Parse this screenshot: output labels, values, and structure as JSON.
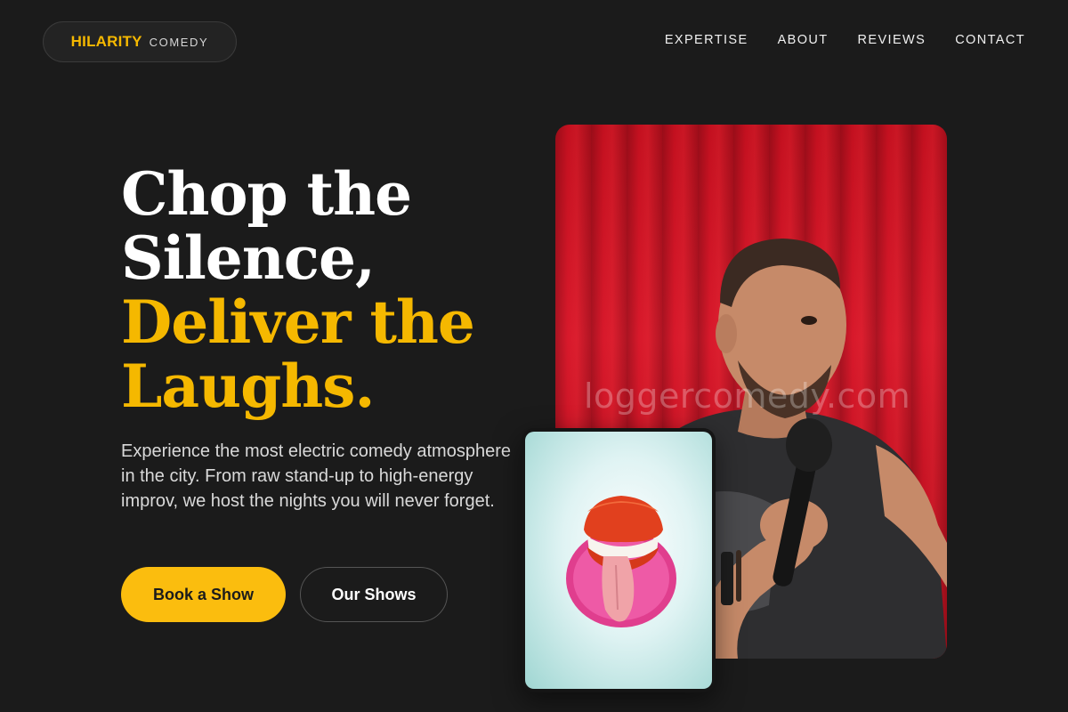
{
  "brand": {
    "name": "HILARITY",
    "suffix": "COMEDY",
    "accent_color": "#f5b800"
  },
  "nav": {
    "items": [
      "EXPERTISE",
      "ABOUT",
      "REVIEWS",
      "CONTACT"
    ]
  },
  "hero": {
    "headline_line1": "Chop the",
    "headline_line2": "Silence,",
    "headline_line3": "Deliver the",
    "headline_line4": "Laughs.",
    "intro": "Experience the most electric comedy atmosphere in the city. From raw stand-up to high-energy improv, we host the nights you will never forget.",
    "primary_button": "Book a Show",
    "secondary_button": "Our Shows"
  },
  "images": {
    "main_photo_watermark": "loggercomedy.com",
    "main_photo_subject": "comedian-with-microphone",
    "secondary_photo_subject": "candy-lips-tongue"
  },
  "colors": {
    "background": "#1b1b1b",
    "primary_button": "#fbbd0e",
    "curtain": "#c3101f"
  }
}
